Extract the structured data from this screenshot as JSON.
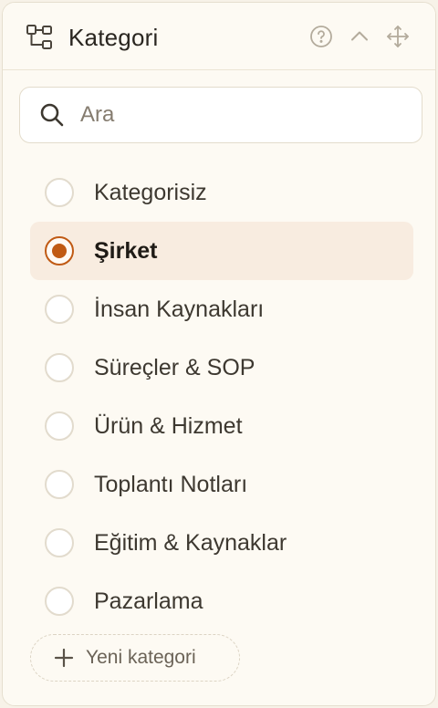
{
  "header": {
    "title": "Kategori",
    "icons": [
      "category-tree-icon",
      "help-circle-icon",
      "chevron-up-icon",
      "move-icon"
    ]
  },
  "search": {
    "value": "",
    "placeholder": "Ara",
    "icon": "search-icon"
  },
  "categories": [
    {
      "label": "Kategorisiz",
      "selected": false
    },
    {
      "label": "Şirket",
      "selected": true
    },
    {
      "label": "İnsan Kaynakları",
      "selected": false
    },
    {
      "label": "Süreçler & SOP",
      "selected": false
    },
    {
      "label": "Ürün & Hizmet",
      "selected": false
    },
    {
      "label": "Toplantı Notları",
      "selected": false
    },
    {
      "label": "Eğitim & Kaynaklar",
      "selected": false
    },
    {
      "label": "Pazarlama",
      "selected": false
    }
  ],
  "new_category": {
    "label": "Yeni kategori",
    "icon": "plus-icon"
  },
  "colors": {
    "accent": "#c05a14",
    "selected_bg": "#f8ece0",
    "panel_bg": "#fdfaf3",
    "page_bg": "#f7f2e8"
  }
}
